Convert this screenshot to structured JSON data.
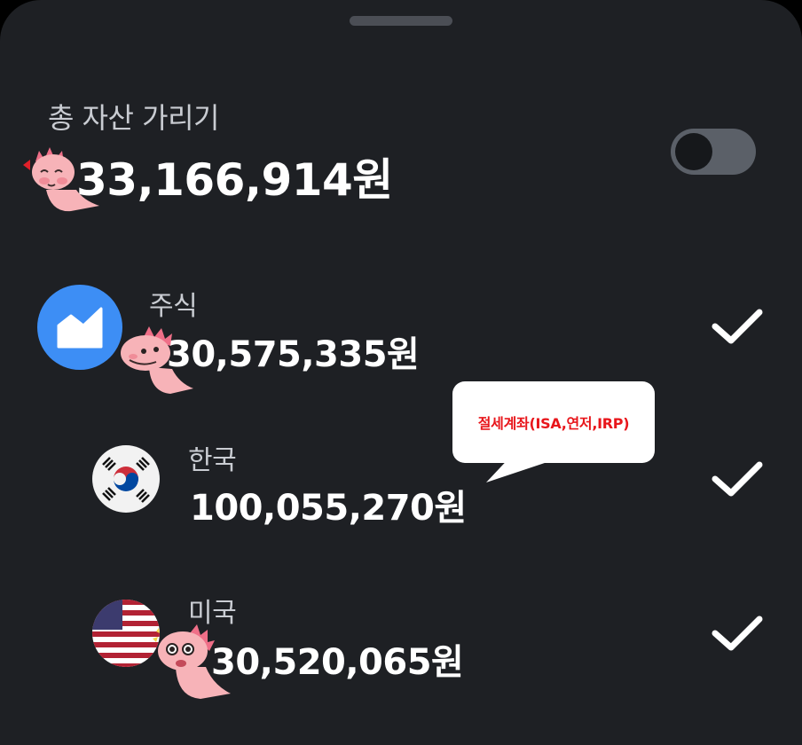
{
  "header": {
    "title": "총 자산 가리기",
    "total_amount": "33,166,914원",
    "hide_toggle_on": false
  },
  "rows": [
    {
      "label": "주식",
      "amount": "30,575,335원",
      "icon": "chart-icon",
      "checked": true
    },
    {
      "label": "한국",
      "amount": "100,055,270원",
      "icon": "korea-flag-icon",
      "checked": true
    },
    {
      "label": "미국",
      "amount": "30,520,065원",
      "icon": "us-flag-icon",
      "checked": true
    }
  ],
  "annotation": {
    "text": "절세계좌(ISA,연저,IRP)",
    "color": "#e8161b"
  },
  "colors": {
    "background": "#1e2024",
    "accent_blue": "#3d8ef5",
    "toggle_track": "#5b6068",
    "text_primary": "#ffffff",
    "text_secondary": "#c9ccd2"
  }
}
